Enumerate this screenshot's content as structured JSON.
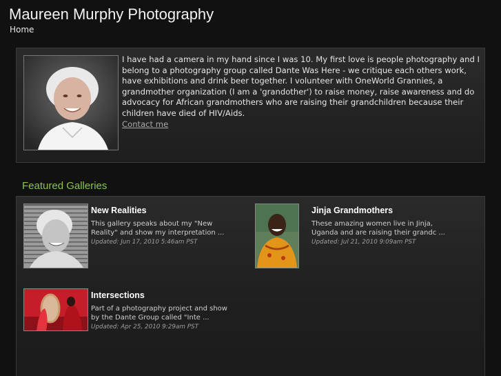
{
  "site": {
    "title": "Maureen Murphy Photography",
    "breadcrumb": "Home"
  },
  "bio": {
    "text": "I have had a camera in my hand since I was 10. My first love is people photography and I belong to a photography group called Dante Was Here - we critique each others work, have exhibitions and drink beer together. I volunteer with OneWorld Grannies, a grandmother organization (I am a 'grandother') to raise money, raise awareness and do advocacy for African grandmothers who are raising their grandchildren because their children have died of HIV/Aids.",
    "contact_label": "Contact me"
  },
  "featured": {
    "heading": "Featured Galleries",
    "galleries": [
      {
        "title": "New Realities",
        "description": "This gallery speaks about my \"New Reality\" and show my interpretation ...",
        "updated": "Updated: Jun 17, 2010 5:46am PST"
      },
      {
        "title": "Jinja Grandmothers",
        "description": "These amazing women live in Jinja, Uganda and are raising their grandc ...",
        "updated": "Updated: Jul 21, 2010 9:09am PST"
      },
      {
        "title": "Intersections",
        "description": "Part of a photography project and show by the Dante Group called \"Inte ...",
        "updated": "Updated: Apr 25, 2010 9:29am PST"
      }
    ]
  }
}
